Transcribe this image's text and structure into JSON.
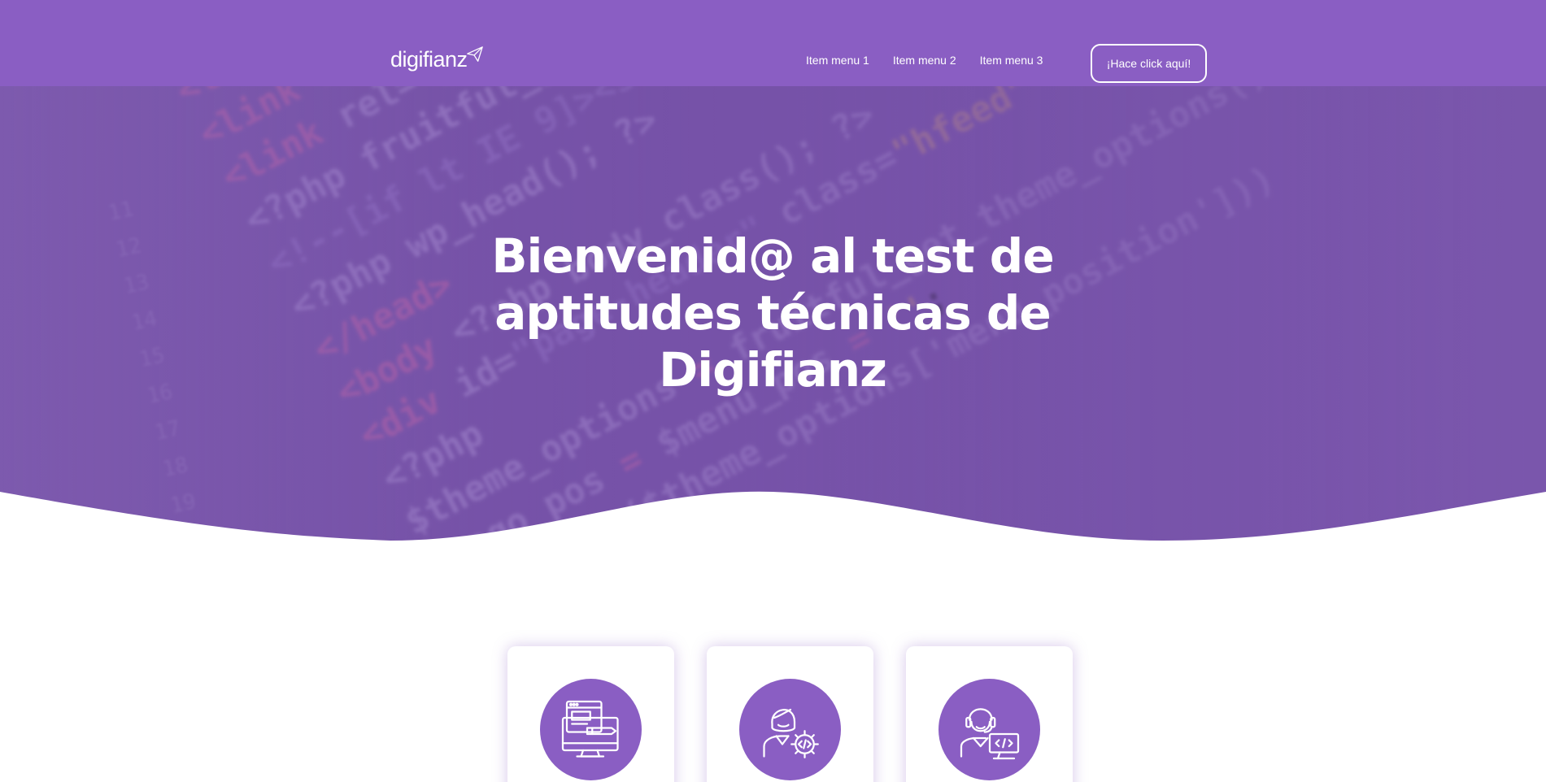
{
  "brand": {
    "logo_text": "digifianz",
    "logo_icon": "paper-plane-icon"
  },
  "nav": {
    "items": [
      {
        "label": "Item menu 1"
      },
      {
        "label": "Item menu 2"
      },
      {
        "label": "Item menu 3"
      }
    ],
    "cta_label": "¡Hace click aquí!"
  },
  "hero": {
    "headline": "Bienvenid@ al test de aptitudes técnicas de Digifianz"
  },
  "cards": [
    {
      "icon": "web-design-monitor-icon"
    },
    {
      "icon": "developer-woman-code-gear-icon"
    },
    {
      "icon": "developer-man-monitor-code-icon"
    }
  ],
  "colors": {
    "primary": "#8a5ec3",
    "hero_overlay": "#7652a8",
    "text_light": "#ffffff",
    "background": "#ffffff"
  }
}
